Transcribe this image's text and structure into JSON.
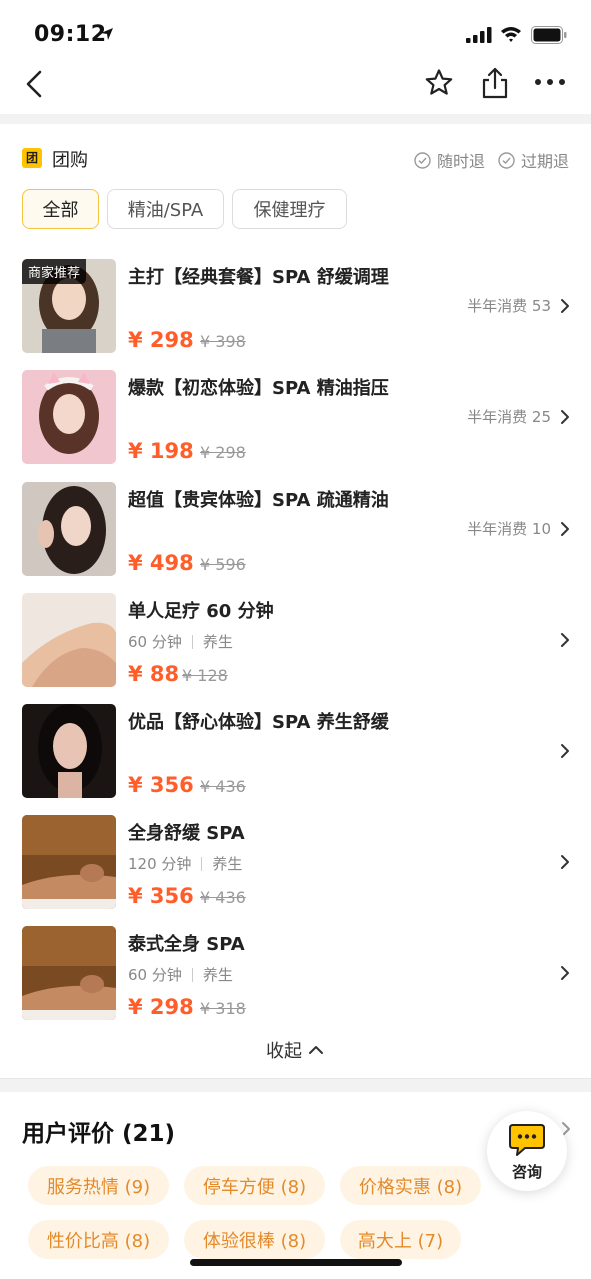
{
  "status_bar": {
    "time": "09:12"
  },
  "group": {
    "badge": "团",
    "title": "团购",
    "guarantee_1": "随时退",
    "guarantee_2": "过期退"
  },
  "filters": [
    "全部",
    "精油/SPA",
    "保健理疗"
  ],
  "deals": [
    {
      "title": "主打【经典套餐】SPA 舒缓调理",
      "tag": "商家推荐",
      "sales": "半年消费 53",
      "price": "¥ 298",
      "orig": "¥ 398",
      "sub": []
    },
    {
      "title": "爆款【初恋体验】SPA 精油指压",
      "sales": "半年消费 25",
      "price": "¥ 198",
      "orig": "¥ 298",
      "sub": []
    },
    {
      "title": "超值【贵宾体验】SPA 疏通精油",
      "sales": "半年消费 10",
      "price": "¥ 498",
      "orig": "¥ 596",
      "sub": []
    },
    {
      "title": "单人足疗 60 分钟",
      "sales": "",
      "price": "¥ 88",
      "orig": "¥ 128",
      "sub": [
        "60 分钟",
        "养生"
      ]
    },
    {
      "title": "优品【舒心体验】SPA 养生舒缓",
      "sales": "",
      "price": "¥ 356",
      "orig": "¥ 436",
      "sub": []
    },
    {
      "title": "全身舒缓 SPA",
      "sales": "",
      "price": "¥ 356",
      "orig": "¥ 436",
      "sub": [
        "120 分钟",
        "养生"
      ]
    },
    {
      "title": "泰式全身 SPA",
      "sales": "",
      "price": "¥ 298",
      "orig": "¥ 318",
      "sub": [
        "60 分钟",
        "养生"
      ]
    }
  ],
  "collapse_label": "收起",
  "reviews": {
    "title": "用户评价 (21)",
    "tags": [
      "服务热情 (9)",
      "停车方便 (8)",
      "价格实惠 (8)",
      "性价比高 (8)",
      "体验很棒 (8)",
      "高大上 (7)"
    ]
  },
  "consult_label": "咨询",
  "colors": {
    "price": "#ff5e2a",
    "accent": "#ffc300",
    "tag_bg": "#fff4e3",
    "tag_text": "#e48a2a"
  }
}
